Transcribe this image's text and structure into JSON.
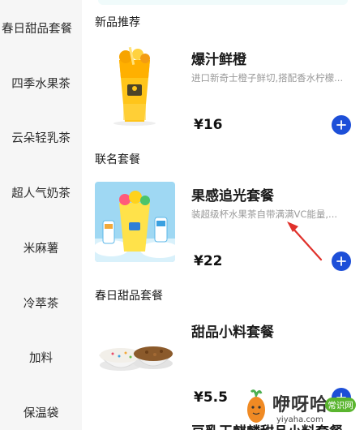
{
  "sidebar": {
    "items": [
      {
        "label": "春日甜品套餐"
      },
      {
        "label": "四季水果茶"
      },
      {
        "label": "云朵轻乳茶"
      },
      {
        "label": "超人气奶茶"
      },
      {
        "label": "米麻薯"
      },
      {
        "label": "冷萃茶"
      },
      {
        "label": "加料"
      },
      {
        "label": "保温袋"
      }
    ]
  },
  "sections": [
    {
      "title": "新品推荐",
      "product": {
        "name": "爆汁鲜橙",
        "desc": "进口新奇士橙子鲜切,搭配香水柠檬...",
        "price": "¥16"
      }
    },
    {
      "title": "联名套餐",
      "product": {
        "name": "果感追光套餐",
        "desc": "装超级杯水果茶自带满满VC能量,...",
        "price": "¥22"
      }
    },
    {
      "title": "春日甜品套餐",
      "product": {
        "name": "甜品小料套餐",
        "desc": "",
        "price": "¥5.5"
      },
      "next_product_name": "豆乳玉麒麟甜品小料套餐"
    }
  ],
  "icons": {
    "add": "plus-icon"
  },
  "colors": {
    "accent": "#1d4fd8",
    "annotation_arrow": "#e0312b",
    "watermark_badge": "#5ab52f"
  },
  "watermark": {
    "text": "咿呀哈",
    "badge": "常识网",
    "url": "yiyaha.com"
  }
}
